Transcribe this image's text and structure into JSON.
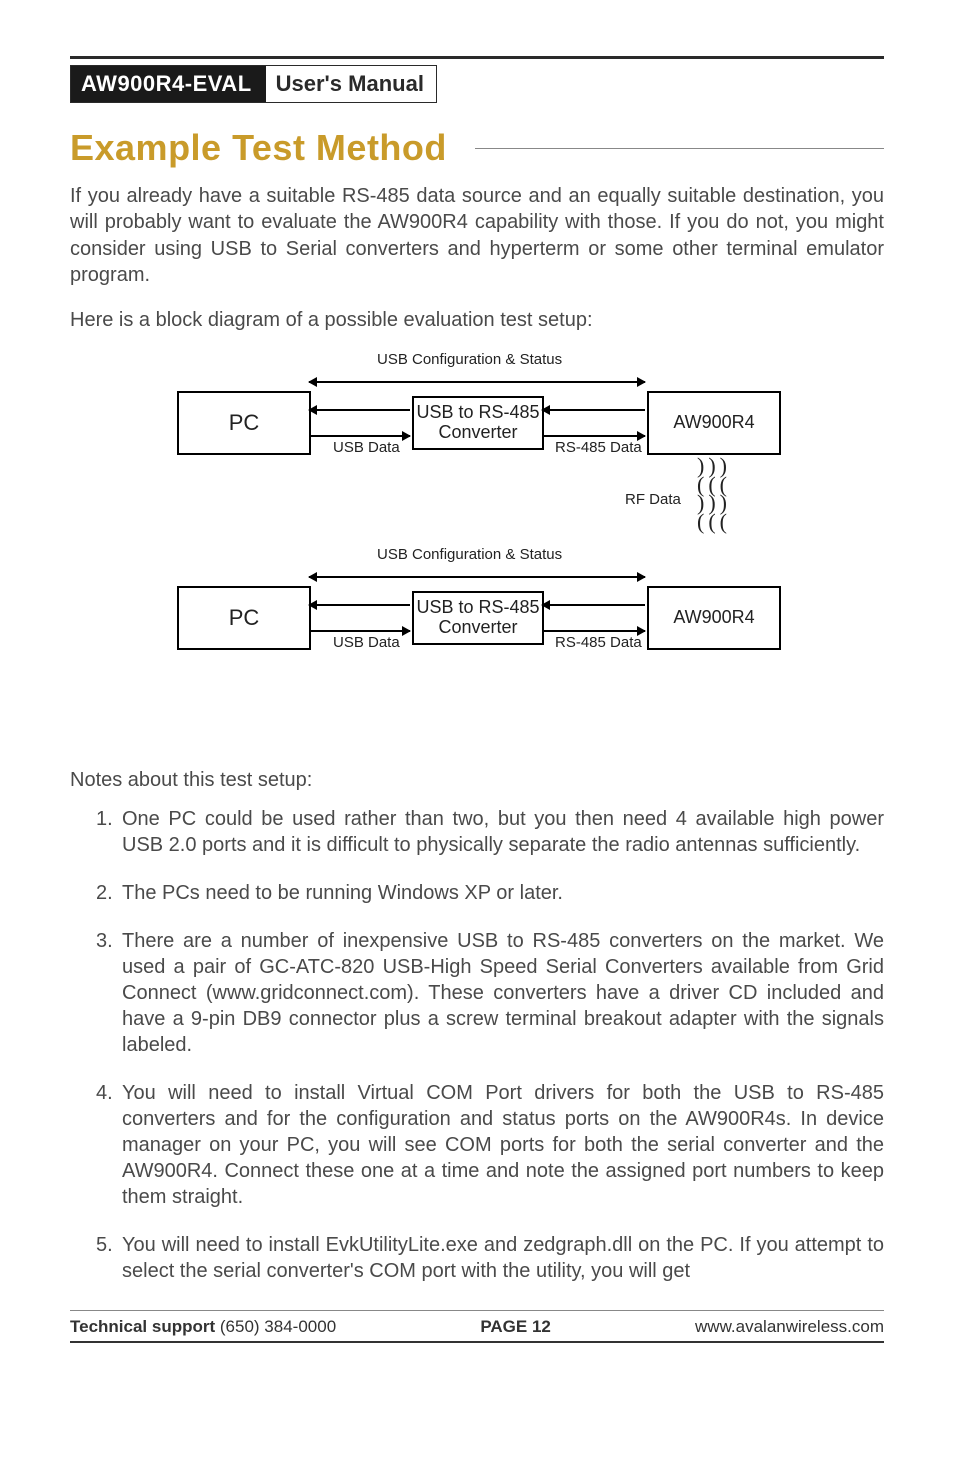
{
  "header": {
    "product": "AW900R4-EVAL",
    "doc_type": "User's Manual"
  },
  "section_title": "Example Test Method",
  "intro_paragraphs": [
    "If you already have a suitable RS-485 data source and an equally suitable destination, you will probably want to evaluate the AW900R4 capability with those. If you do not, you might consider using USB to Serial converters and hyperterm or some other terminal emulator program.",
    "Here is a block diagram of a possible evaluation test setup:"
  ],
  "diagram": {
    "top_config_label": "USB Configuration & Status",
    "bottom_config_label": "USB Configuration & Status",
    "pc_label": "PC",
    "converter_label_line1": "USB to RS-485",
    "converter_label_line2": "Converter",
    "radio_label": "AW900R4",
    "usb_data_label": "USB Data",
    "rs485_data_label": "RS-485 Data",
    "rf_data_label": "RF Data"
  },
  "notes_intro": "Notes about this test setup:",
  "notes": [
    "One PC could be used rather than two, but you then need 4 available high power USB 2.0 ports and it is difficult to physically separate the radio antennas sufficiently.",
    "The PCs need to be running Windows XP or later.",
    "There are a number of inexpensive USB to RS-485 converters on the market. We used a pair of GC-ATC-820 USB-High Speed Serial Converters available from Grid Connect (www.gridconnect.com). These converters have a driver CD included and have a 9-pin DB9 connector plus a screw terminal breakout adapter with the signals labeled.",
    "You will need to install Virtual COM Port drivers for both the USB to RS-485 converters and for the configuration and status ports on the AW900R4s. In device manager on your PC, you will see COM ports for both the serial converter and the AW900R4. Connect these one at a time and note the assigned port numbers to keep them straight.",
    "You will need to install EvkUtilityLite.exe and zedgraph.dll on the PC. If you attempt to select the serial converter's COM port with the utility, you will get"
  ],
  "footer": {
    "support_label": "Technical support",
    "support_phone": "(650) 384-0000",
    "page_label": "PAGE 12",
    "url": "www.avalanwireless.com"
  }
}
